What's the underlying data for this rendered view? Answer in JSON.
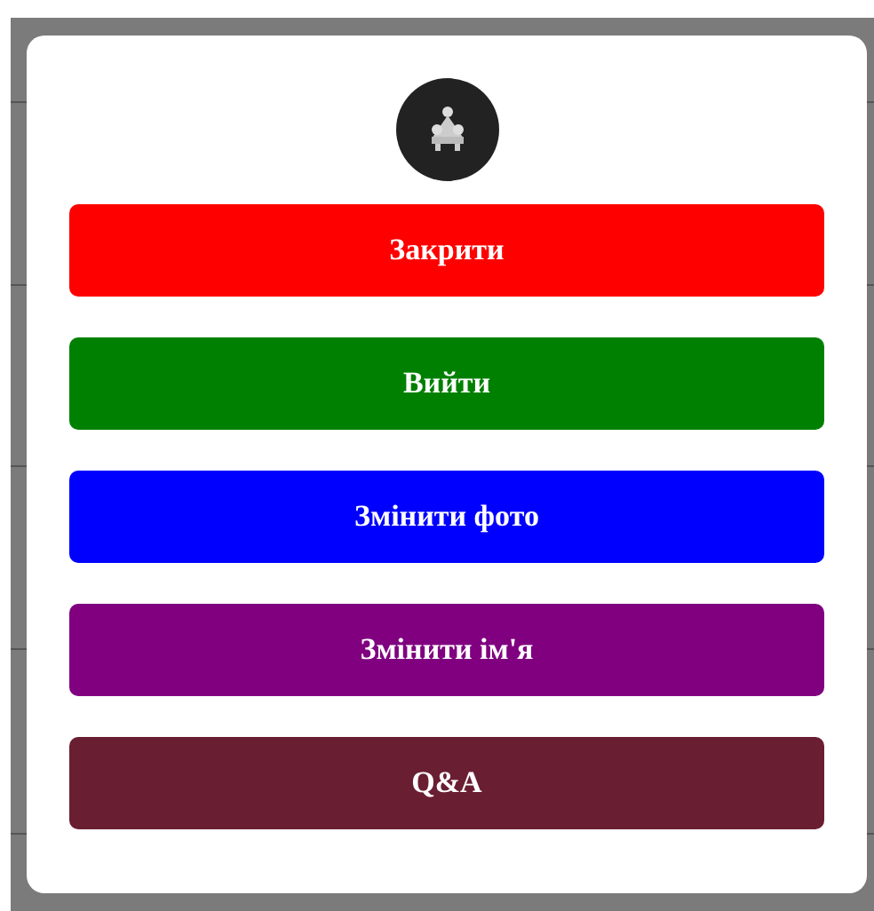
{
  "buttons": [
    {
      "label": "Закрити",
      "color": "#ff0000"
    },
    {
      "label": "Вийти",
      "color": "#008000"
    },
    {
      "label": "Змінити фото",
      "color": "#0000ff"
    },
    {
      "label": "Змінити ім'я",
      "color": "#800080"
    },
    {
      "label": "Q&A",
      "color": "#6a1e32"
    }
  ]
}
